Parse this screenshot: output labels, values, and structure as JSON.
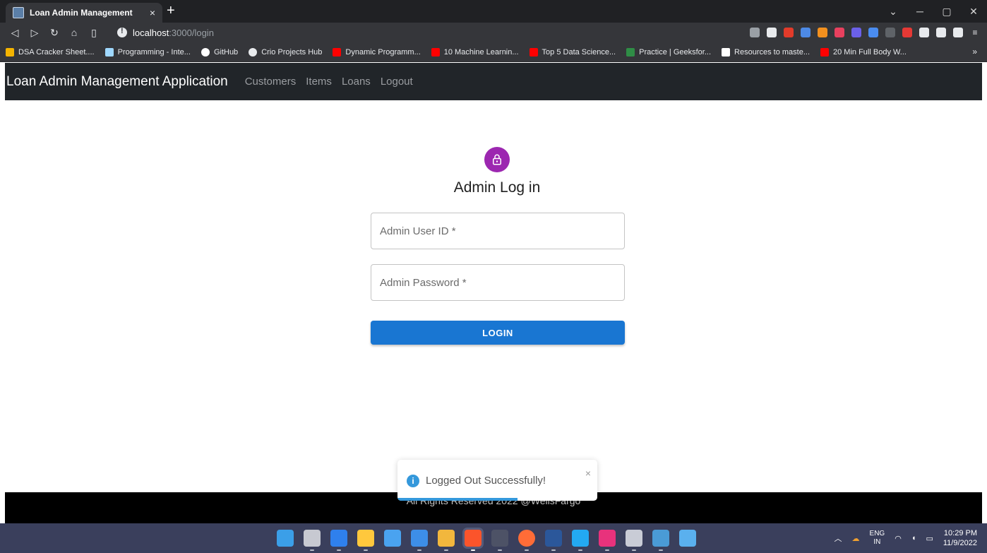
{
  "browser": {
    "tab_title": "Loan Admin Management",
    "tab_close": "×",
    "new_tab": "+",
    "url_host": "localhost",
    "url_path": ":3000/login",
    "bookmarks": [
      {
        "label": "DSA Cracker Sheet....",
        "color": "#f4b400"
      },
      {
        "label": "Programming - Inte...",
        "color": "#9fd8ff"
      },
      {
        "label": "GitHub",
        "color": "#ffffff"
      },
      {
        "label": "Crio Projects Hub",
        "color": "#e8eaed"
      },
      {
        "label": "Dynamic Programm...",
        "color": "#ff0000"
      },
      {
        "label": "10 Machine Learnin...",
        "color": "#ff0000"
      },
      {
        "label": "Top 5 Data Science...",
        "color": "#ff0000"
      },
      {
        "label": "Practice | Geeksfor...",
        "color": "#2f8d46"
      },
      {
        "label": "Resources to maste...",
        "color": "#ffffff"
      },
      {
        "label": "20 Min Full Body W...",
        "color": "#ff0000"
      }
    ],
    "bookmarks_more": "»"
  },
  "app": {
    "brand": "Loan Admin Management Application",
    "nav": [
      "Customers",
      "Items",
      "Loans",
      "Logout"
    ],
    "login_title": "Admin Log in",
    "user_placeholder": "Admin User ID *",
    "password_placeholder": "Admin Password *",
    "login_button": "LOGIN",
    "footer": "All Rights Reserved 2022 @WellsFargo",
    "accent_color": "#1976d2",
    "avatar_color": "#9c27b0"
  },
  "toast": {
    "message": "Logged Out Successfully!",
    "close": "×",
    "progress": 0.6
  },
  "taskbar": {
    "lang_top": "ENG",
    "lang_bottom": "IN",
    "time": "10:29 PM",
    "date": "11/9/2022"
  }
}
